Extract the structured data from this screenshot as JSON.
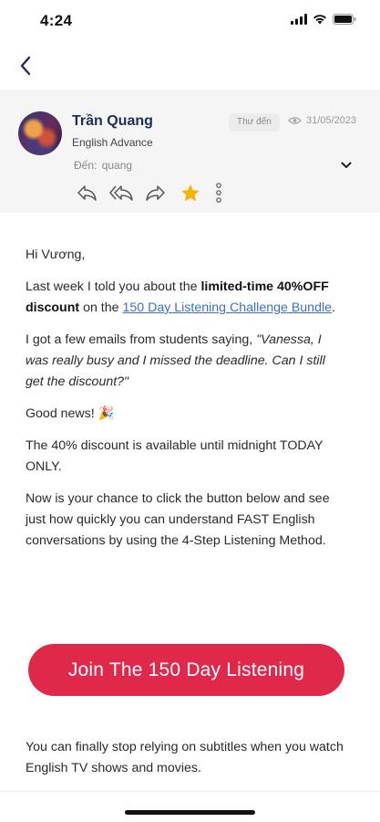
{
  "status_bar": {
    "time": "4:24"
  },
  "email": {
    "sender_name": "Trần Quang",
    "sender_tag": "English Advance",
    "folder": "Thư đến",
    "date": "31/05/2023",
    "to_label": "Đến:",
    "to_value": "quang",
    "starred": true
  },
  "body": {
    "greeting": "Hi Vương,",
    "p1_a": "Last week I told you about the ",
    "p1_bold": "limited-time 40%OFF discount",
    "p1_b": " on the ",
    "p1_link": "150 Day Listening Challenge Bundle",
    "p1_c": ".",
    "p2_a": "I got a few emails from students saying, ",
    "p2_italic": "\"Vanessa, I was really busy and I missed the deadline. Can I still get the discount?\"",
    "p3": "Good news! 🎉",
    "p4": "The 40% discount is available until midnight TODAY ONLY.",
    "p5": "Now is your chance to click the button below and see just how quickly you can understand FAST English conversations by using the 4-Step Listening Method.",
    "cta_label": "Join The 150 Day Listening",
    "p6": "You can finally stop relying on subtitles when you watch English TV shows and movies."
  },
  "colors": {
    "accent": "#e0284a",
    "star": "#f5b400",
    "link": "#3a6fd0",
    "name": "#1f2d5a"
  },
  "icons": [
    "back-chevron-icon",
    "eye-icon",
    "chevron-down-icon",
    "reply-icon",
    "reply-all-icon",
    "forward-icon",
    "star-icon",
    "more-vertical-icon"
  ]
}
